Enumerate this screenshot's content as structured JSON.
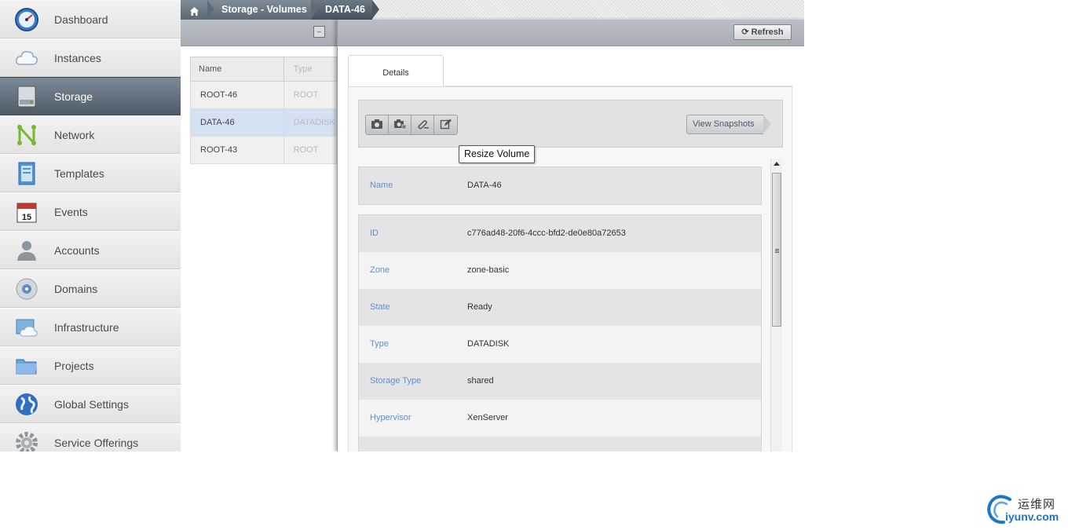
{
  "sidebar": {
    "items": [
      {
        "label": "Dashboard",
        "icon": "dashboard-gauge-icon",
        "active": false
      },
      {
        "label": "Instances",
        "icon": "cloud-icon",
        "active": false
      },
      {
        "label": "Storage",
        "icon": "hard-drive-icon",
        "active": true
      },
      {
        "label": "Network",
        "icon": "network-icon",
        "active": false
      },
      {
        "label": "Templates",
        "icon": "template-icon",
        "active": false
      },
      {
        "label": "Events",
        "icon": "calendar-icon",
        "active": false
      },
      {
        "label": "Accounts",
        "icon": "user-icon",
        "active": false
      },
      {
        "label": "Domains",
        "icon": "domain-disc-icon",
        "active": false
      },
      {
        "label": "Infrastructure",
        "icon": "infrastructure-icon",
        "active": false
      },
      {
        "label": "Projects",
        "icon": "folder-icon",
        "active": false
      },
      {
        "label": "Global Settings",
        "icon": "globe-icon",
        "active": false
      },
      {
        "label": "Service Offerings",
        "icon": "gear-icon",
        "active": false
      }
    ],
    "events_day": "15"
  },
  "breadcrumb": {
    "home_icon": "home-icon",
    "items": [
      "Storage - Volumes",
      "DATA-46"
    ]
  },
  "list": {
    "columns": [
      "Name",
      "Type"
    ],
    "rows": [
      {
        "name": "ROOT-46",
        "type": "ROOT",
        "selected": false
      },
      {
        "name": "DATA-46",
        "type": "DATADISK",
        "selected": true
      },
      {
        "name": "ROOT-43",
        "type": "ROOT",
        "selected": false
      }
    ]
  },
  "detail": {
    "refresh_label": "Refresh",
    "tab_label": "Details",
    "view_snapshots_label": "View Snapshots",
    "tooltip": "Resize Volume",
    "actions": [
      "take-snapshot-icon",
      "recurring-snapshot-icon",
      "detach-volume-icon",
      "resize-volume-icon"
    ],
    "name_field": {
      "label": "Name",
      "value": "DATA-46"
    },
    "fields": [
      {
        "label": "ID",
        "value": "c776ad48-20f6-4ccc-bfd2-de0e80a72653"
      },
      {
        "label": "Zone",
        "value": "zone-basic"
      },
      {
        "label": "State",
        "value": "Ready"
      },
      {
        "label": "Type",
        "value": "DATADISK"
      },
      {
        "label": "Storage Type",
        "value": "shared"
      },
      {
        "label": "Hypervisor",
        "value": "XenServer"
      }
    ]
  },
  "watermark": {
    "cn": "运维网",
    "en": "iyunv.com"
  },
  "colors": {
    "accent": "#5f8fcc",
    "nav_active": "#4d5a67",
    "selected_row": "#d3e1f2"
  }
}
